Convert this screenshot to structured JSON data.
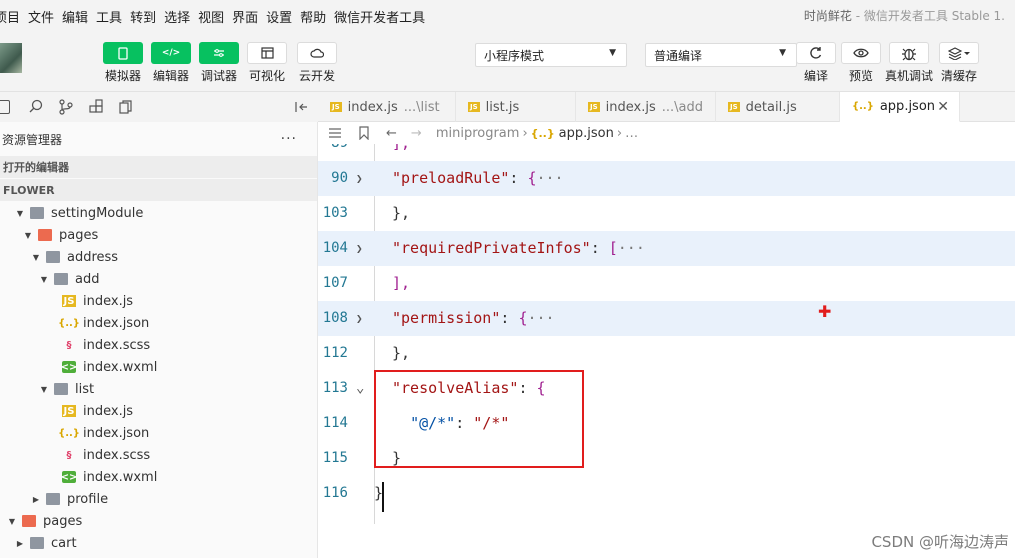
{
  "menubar": {
    "items": [
      "项目",
      "文件",
      "编辑",
      "工具",
      "转到",
      "选择",
      "视图",
      "界面",
      "设置",
      "帮助",
      "微信开发者工具"
    ],
    "title_app": "时尚鲜花",
    "title_tool": " - 微信开发者工具 Stable 1."
  },
  "toolbar": {
    "buttons": [
      {
        "label": "模拟器",
        "icon": "phone-icon",
        "style": "green"
      },
      {
        "label": "编辑器",
        "icon": "code-icon",
        "style": "green"
      },
      {
        "label": "调试器",
        "icon": "debug-toggle-icon",
        "style": "green"
      },
      {
        "label": "可视化",
        "icon": "layout-icon",
        "style": "white"
      },
      {
        "label": "云开发",
        "icon": "cloud-icon",
        "style": "white"
      }
    ],
    "mode_select": "小程序模式",
    "compile_select": "普通编译",
    "right_buttons": [
      {
        "label": "编译",
        "icon": "refresh-icon"
      },
      {
        "label": "预览",
        "icon": "eye-icon"
      },
      {
        "label": "真机调试",
        "icon": "bug-icon"
      },
      {
        "label": "清缓存",
        "icon": "layers-icon"
      }
    ]
  },
  "tabs": [
    {
      "name": "index.js",
      "sub": "...\\list",
      "icon": "JS"
    },
    {
      "name": "list.js",
      "sub": "",
      "icon": "JS"
    },
    {
      "name": "index.js",
      "sub": "...\\add",
      "icon": "JS"
    },
    {
      "name": "detail.js",
      "sub": "",
      "icon": "JS"
    },
    {
      "name": "app.json",
      "sub": "",
      "icon": "{..}",
      "active": true
    }
  ],
  "sidebar": {
    "header": "资源管理器",
    "more": "···",
    "open_editors": "打开的编辑器",
    "project": "FLOWER",
    "tree": [
      {
        "label": "settingModule",
        "type": "folder",
        "depth": 1,
        "open": true
      },
      {
        "label": "pages",
        "type": "pages",
        "depth": 2,
        "open": true
      },
      {
        "label": "address",
        "type": "folder",
        "depth": 3,
        "open": true
      },
      {
        "label": "add",
        "type": "folder",
        "depth": 4,
        "open": true
      },
      {
        "label": "index.js",
        "type": "js",
        "depth": 5
      },
      {
        "label": "index.json",
        "type": "json",
        "depth": 5
      },
      {
        "label": "index.scss",
        "type": "scss",
        "depth": 5
      },
      {
        "label": "index.wxml",
        "type": "wxml",
        "depth": 5
      },
      {
        "label": "list",
        "type": "folder",
        "depth": 4,
        "open": true
      },
      {
        "label": "index.js",
        "type": "js",
        "depth": 5
      },
      {
        "label": "index.json",
        "type": "json",
        "depth": 5
      },
      {
        "label": "index.scss",
        "type": "scss",
        "depth": 5
      },
      {
        "label": "index.wxml",
        "type": "wxml",
        "depth": 5
      },
      {
        "label": "profile",
        "type": "folder",
        "depth": 3,
        "open": false
      },
      {
        "label": "pages",
        "type": "pages",
        "depth": 0,
        "open": true
      },
      {
        "label": "cart",
        "type": "folder",
        "depth": 1,
        "open": false
      }
    ]
  },
  "breadcrumb": {
    "root": "miniprogram",
    "file": "app.json",
    "tail": "…"
  },
  "code": [
    {
      "ln": "89",
      "text": "],",
      "fold": false,
      "chev": ""
    },
    {
      "ln": "90",
      "key": "preloadRule",
      "after": ": {",
      "ell": "···",
      "fold": true,
      "chev": "right"
    },
    {
      "ln": "103",
      "text": "},",
      "fold": false,
      "chev": ""
    },
    {
      "ln": "104",
      "key": "requiredPrivateInfos",
      "after": ": [",
      "ell": "···",
      "fold": true,
      "chev": "right"
    },
    {
      "ln": "107",
      "text": "],",
      "fold": false,
      "chev": ""
    },
    {
      "ln": "108",
      "key": "permission",
      "after": ": {",
      "ell": "···",
      "fold": true,
      "chev": "right"
    },
    {
      "ln": "112",
      "text": "},",
      "fold": false,
      "chev": ""
    },
    {
      "ln": "113",
      "key": "resolveAlias",
      "after": ": {",
      "fold": false,
      "chev": "down"
    },
    {
      "ln": "114",
      "key2": "@/*",
      "val": "/*",
      "fold": false,
      "chev": ""
    },
    {
      "ln": "115",
      "text": "}",
      "fold": false,
      "chev": ""
    },
    {
      "ln": "116",
      "text": "}",
      "fold": false,
      "chev": "",
      "cursor": true
    }
  ],
  "watermark": "CSDN @听海边涛声",
  "colors": {
    "green": "#07c160",
    "highlight": "#e11d1d",
    "fold_bg": "#e9f1fb"
  }
}
